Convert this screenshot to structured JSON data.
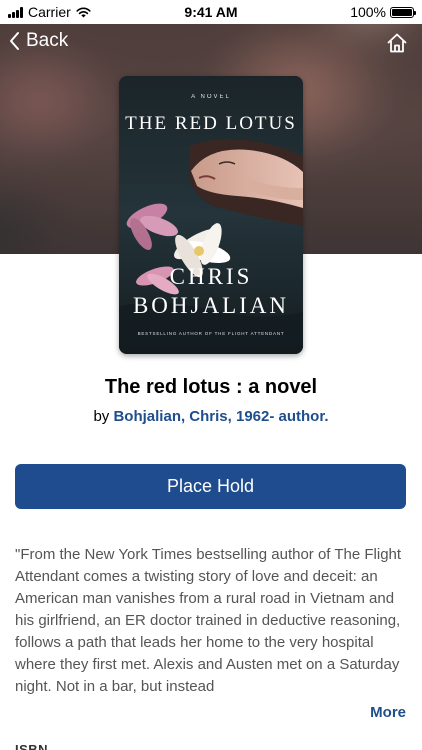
{
  "status_bar": {
    "carrier": "Carrier",
    "time": "9:41 AM",
    "battery": "100%",
    "battery_level": 1.0
  },
  "nav": {
    "back_label": "Back",
    "back_icon": "chevron-left-icon",
    "home_icon": "home-icon"
  },
  "cover": {
    "kicker": "A NOVEL",
    "title": "THE RED LOTUS",
    "author_first": "CHRIS",
    "author_last": "BOHJALIAN",
    "tagline": "BESTSELLING AUTHOR OF THE FLIGHT ATTENDANT"
  },
  "book": {
    "title": "The red lotus : a novel",
    "by_prefix": "by",
    "author": "Bohjalian, Chris, 1962- author."
  },
  "actions": {
    "place_hold": "Place Hold",
    "more": "More"
  },
  "summary": "\"From the New York Times bestselling author of The Flight Attendant comes a twisting story of love and deceit: an American man vanishes from a rural road in Vietnam and his girlfriend, an ER doctor trained in deductive reasoning, follows a path that leads her home to the very hospital where they first met. Alexis and Austen met on a Saturday night. Not in a bar, but instead",
  "details": {
    "isbn_label": "ISBN"
  },
  "colors": {
    "accent": "#1f4b8f",
    "link": "#1f4e8c",
    "summary_text": "#555555"
  }
}
